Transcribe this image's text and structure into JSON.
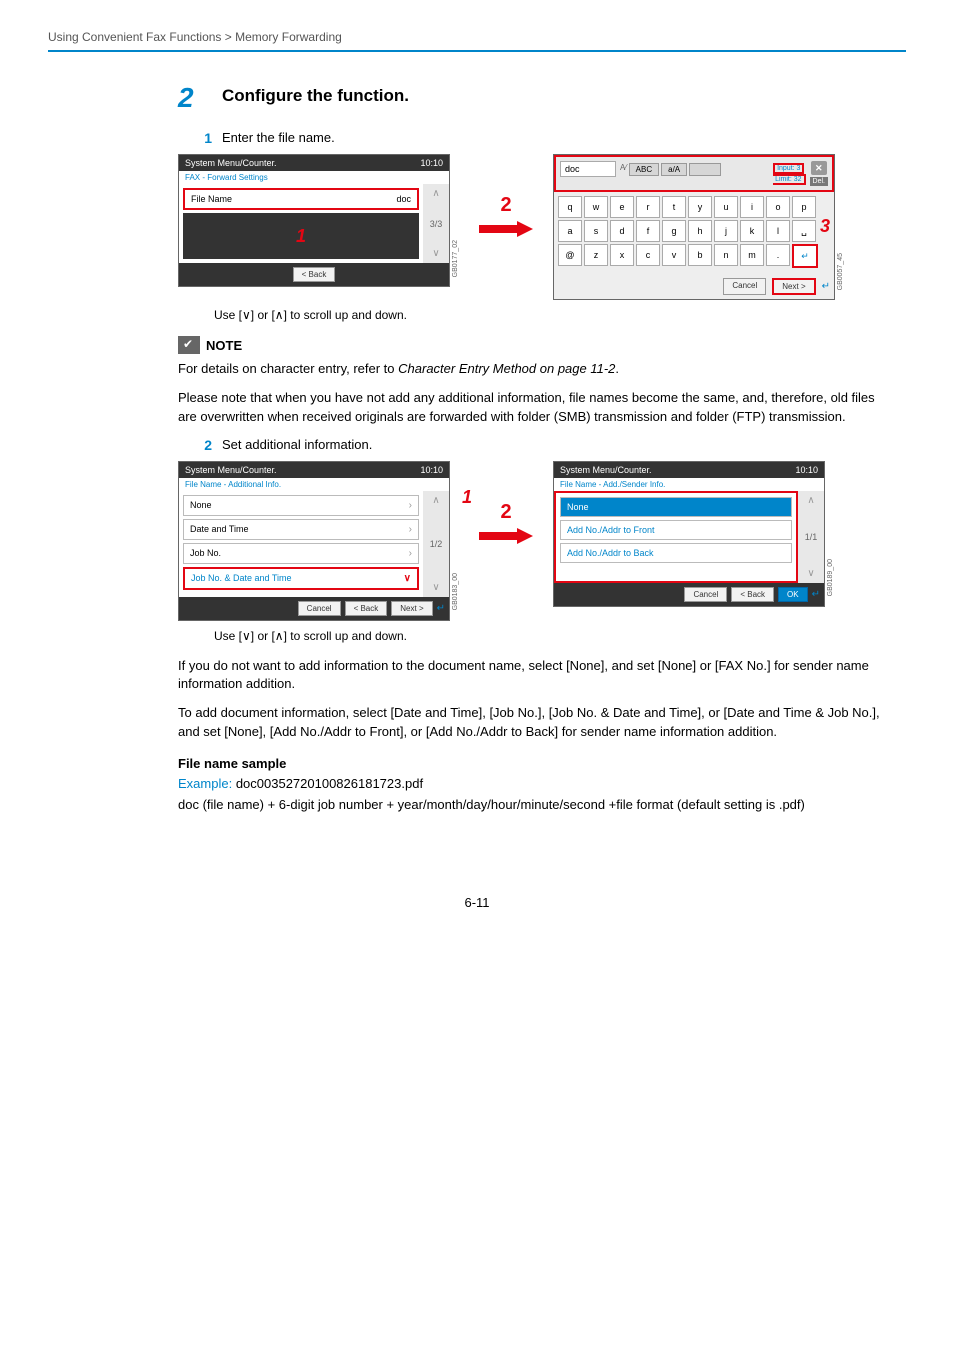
{
  "breadcrumb": "Using Convenient Fax Functions > Memory Forwarding",
  "step2": {
    "num": "2",
    "title": "Configure the function.",
    "sub1_num": "1",
    "sub1_text": "Enter the file name.",
    "sub2_num": "2",
    "sub2_text": "Set additional information."
  },
  "panelA": {
    "title": "System Menu/Counter.",
    "time": "10:10",
    "subtitle": "FAX - Forward Settings",
    "row_label": "File Name",
    "row_value": "doc",
    "page": "3/3",
    "btn_back": "< Back",
    "code": "GB0177_02",
    "overlay1": "1"
  },
  "arrow12": {
    "num": "2"
  },
  "keyboard": {
    "value": "doc",
    "tab1": "ABC",
    "tab2": "a/A",
    "info1": "Input: 3",
    "info2": "Limit: 32",
    "del": "Del.",
    "row1": [
      "q",
      "w",
      "e",
      "r",
      "t",
      "y",
      "u",
      "i",
      "o",
      "p"
    ],
    "row2": [
      "a",
      "s",
      "d",
      "f",
      "g",
      "h",
      "j",
      "k",
      "l",
      "␣"
    ],
    "row3": [
      "@",
      "z",
      "x",
      "c",
      "v",
      "b",
      "n",
      "m",
      ".",
      "↵"
    ],
    "overlay3": "3",
    "btn_cancel": "Cancel",
    "btn_next": "Next >",
    "code": "GB0057_45"
  },
  "caption_scroll": "Use [∨] or [∧] to scroll up and down.",
  "note": {
    "title": "NOTE",
    "line1a": "For details on character entry, refer to ",
    "line1b": "Character Entry Method on page 11-2",
    "line1c": ".",
    "para2": "Please note that when you have not add any additional information, file names become the same, and, therefore, old files are overwritten when received originals are forwarded with folder (SMB) transmission and folder (FTP) transmission."
  },
  "panelB": {
    "title": "System Menu/Counter.",
    "time": "10:10",
    "subtitle": "File Name - Additional Info.",
    "rows": [
      "None",
      "Date and Time",
      "Job No.",
      "Job No. & Date and Time"
    ],
    "page": "1/2",
    "btn_cancel": "Cancel",
    "btn_back": "< Back",
    "btn_next": "Next >",
    "code": "GB0183_00",
    "overlay1": "1"
  },
  "arrow34": {
    "num": "2"
  },
  "panelC": {
    "title": "System Menu/Counter.",
    "time": "10:10",
    "subtitle": "File Name - Add./Sender Info.",
    "rows": [
      "None",
      "Add No./Addr to Front",
      "Add No./Addr to Back"
    ],
    "page": "1/1",
    "btn_cancel": "Cancel",
    "btn_back": "< Back",
    "btn_ok": "OK",
    "code": "GB0189_00"
  },
  "body": {
    "p1": "If you do not want to add information to the document name, select [None], and set [None] or [FAX No.] for sender name information addition.",
    "p2": "To add document information, select [Date and Time], [Job No.], [Job No. & Date and Time], or [Date and Time & Job No.], and set [None], [Add No./Addr to Front], or [Add No./Addr to Back] for sender name information addition.",
    "h": "File name sample",
    "ex_label": "Example: ",
    "ex_value": "doc00352720100826181723.pdf",
    "ex_desc": "doc (file name) + 6-digit job number + year/month/day/hour/minute/second +file format (default setting is .pdf)"
  },
  "pagenum": "6-11"
}
